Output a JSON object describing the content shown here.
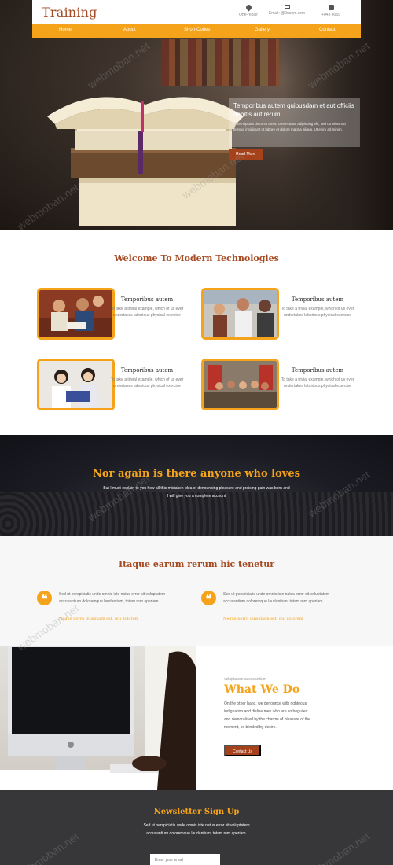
{
  "header": {
    "logo": "Training",
    "contact": [
      {
        "icon": "map-pin-icon",
        "label": "One-repair"
      },
      {
        "icon": "mail-icon",
        "label": "Email: @9ucom.com"
      },
      {
        "icon": "phone-icon",
        "label": "+048 4059"
      }
    ]
  },
  "nav": {
    "items": [
      "Home",
      "About",
      "Short Codes",
      "Gallery",
      "Contact"
    ]
  },
  "hero": {
    "title": "Temporibus autem quibusdam et aut officiis debitis aut rerum.",
    "text": "Lorem ipsum dolor sit amet, consectetur adipiscing elit, sed do eiusmod tempor incididunt ut labore et dolore magna aliqua. Ut enim ad minim.",
    "button": "Read More"
  },
  "welcome": {
    "title": "Welcome To Modern Technologies",
    "features": [
      {
        "title": "Temporibus autem",
        "text": "To take a trivial example, which of us ever undertakes laborious physical exercise"
      },
      {
        "title": "Temporibus autem",
        "text": "To take a trivial example, which of us ever undertakes laborious physical exercise"
      },
      {
        "title": "Temporibus autem",
        "text": "To take a trivial example, which of us ever undertakes laborious physical exercise"
      },
      {
        "title": "Temporibus autem",
        "text": "To take a trivial example, which of us ever undertakes laborious physical exercise"
      }
    ]
  },
  "band": {
    "title": "Nor again is there anyone who loves",
    "text": "But I must explain to you how all this mistaken idea of denouncing pleasure and praising pain was born and I will give you a complete account"
  },
  "testimonials": {
    "title": "Itaque earum rerum hic tenetur",
    "items": [
      {
        "text": "Sed ut perspiciatis unde omnis iste natus error sit voluptatem accusantium doloremque laudantium, totam rem aperiam.",
        "link": "Neque porro quisquam est, qui dolorem"
      },
      {
        "text": "Sed ut perspiciatis unde omnis iste natus error sit voluptatem accusantium doloremque laudantium, totam rem aperiam.",
        "link": "Neque porro quisquam est, qui dolorem"
      }
    ]
  },
  "whatwedo": {
    "subtitle": "voluptatem accusantium",
    "title": "What We Do",
    "text": "On the other hand, we denounce with righteous indignation and dislike men who are so beguiled and demoralized by the charms of pleasure of the moment, so blinded by desire.",
    "button": "Contact Us"
  },
  "newsletter": {
    "title": "Newsletter Sign Up",
    "text": "Sed ut perspiciatis unde omnis iste natus error sit voluptatem accusantium doloremque laudantium, totam rem aperiam.",
    "placeholder": "Enter your email"
  },
  "watermark": "webmoban.net",
  "colors": {
    "accent": "#f5a31a",
    "brand": "#a54a22",
    "button": "#a5421c",
    "dark": "#37373a"
  }
}
